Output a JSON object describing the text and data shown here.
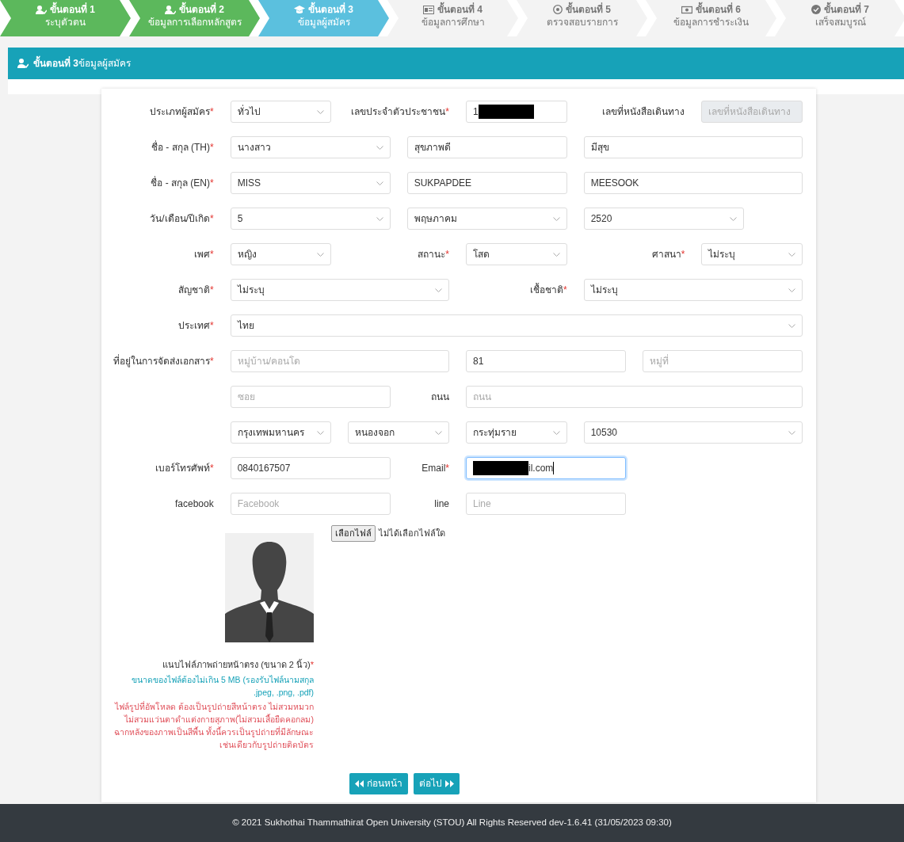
{
  "steps": [
    {
      "number_label": "ขั้นตอนที่ 1",
      "title": "ระบุตัวตน",
      "completed": true,
      "selected": false
    },
    {
      "number_label": "ขั้นตอนที่ 2",
      "title": "ข้อมูลการเลือกหลักสูตร",
      "completed": true,
      "selected": false
    },
    {
      "number_label": "ขั้นตอนที่ 3",
      "title": "ข้อมูลผู้สมัคร",
      "completed": false,
      "selected": true
    },
    {
      "number_label": "ขั้นตอนที่ 4",
      "title": "ข้อมูลการศึกษา",
      "completed": false,
      "selected": false
    },
    {
      "number_label": "ขั้นตอนที่ 5",
      "title": "ตรวจสอบรายการ",
      "completed": false,
      "selected": false
    },
    {
      "number_label": "ขั้นตอนที่ 6",
      "title": "ข้อมูลการชำระเงิน",
      "completed": false,
      "selected": false
    },
    {
      "number_label": "ขั้นตอนที่ 7",
      "title": "เสร็จสมบูรณ์",
      "completed": false,
      "selected": false
    }
  ],
  "section_title": "**ขั้นตอนที่ 3**ข้อมูลผู้สมัคร",
  "form": {
    "rows": [
      {
        "items": [
          {
            "kind": "label",
            "text": "ประเภทผู้สมัคร",
            "mark": "*"
          },
          {
            "kind": "select",
            "value": "ทั่วไป"
          },
          {
            "kind": "label",
            "text": "เลขประจำตัวประชาชน",
            "mark": "*"
          },
          {
            "kind": "input",
            "value": "1",
            "redacted_start": false,
            "redacted_end": true,
            "disabled": false,
            "focused": false
          },
          {
            "kind": "label",
            "text": "เลขที่หนังสือเดินทาง"
          },
          {
            "kind": "input",
            "placeholder": "เลขที่หนังสือเดินทาง",
            "disabled": true,
            "focused": false
          }
        ]
      },
      {
        "items": [
          {
            "kind": "label",
            "text": "ชื่อ - สกุล (TH)",
            "mark": "*"
          },
          {
            "kind": "select",
            "value": "นางสาว"
          },
          {
            "kind": "input",
            "value": "สุขภาพดี",
            "disabled": false,
            "focused": false
          },
          {
            "kind": "input",
            "value": "มีสุข",
            "disabled": false,
            "focused": false
          }
        ]
      },
      {
        "items": [
          {
            "kind": "label",
            "text": "ชื่อ - สกุล (EN)",
            "mark": "*"
          },
          {
            "kind": "select",
            "value": "MISS"
          },
          {
            "kind": "input",
            "value": "SUKPAPDEE",
            "disabled": false,
            "focused": false
          },
          {
            "kind": "input",
            "value": "MEESOOK",
            "disabled": false,
            "focused": false
          }
        ]
      },
      {
        "items": [
          {
            "kind": "label",
            "text": "วัน/เดือน/ปีเกิด",
            "mark": "*"
          },
          {
            "kind": "select",
            "value": "5"
          },
          {
            "kind": "select",
            "value": "พฤษภาคม"
          },
          {
            "kind": "select",
            "value": "2520"
          }
        ]
      },
      {
        "items": [
          {
            "kind": "label",
            "text": "เพศ",
            "mark": "*"
          },
          {
            "kind": "select",
            "value": "หญิง"
          },
          {
            "kind": "label",
            "text": "สถานะ",
            "mark": "*"
          },
          {
            "kind": "select",
            "value": "โสด"
          },
          {
            "kind": "label",
            "text": "ศาสนา",
            "mark": "*"
          },
          {
            "kind": "select",
            "value": "ไม่ระบุ"
          }
        ]
      },
      {
        "items": [
          {
            "kind": "label",
            "text": "สัญชาติ",
            "mark": "*"
          },
          {
            "kind": "select",
            "value": "ไม่ระบุ"
          },
          {
            "kind": "label",
            "text": "เชื้อชาติ",
            "mark": "*"
          },
          {
            "kind": "select",
            "value": "ไม่ระบุ"
          }
        ]
      },
      {
        "items": [
          {
            "kind": "label",
            "text": "ประเทศ",
            "mark": "*"
          },
          {
            "kind": "select",
            "value": "ไทย"
          }
        ]
      },
      {
        "items": [
          {
            "kind": "label",
            "text": "ที่อยู่ในการจัดส่งเอกสาร",
            "mark": "*"
          },
          {
            "kind": "input",
            "placeholder": "หมู่บ้าน/คอนโด",
            "disabled": false,
            "focused": false
          },
          {
            "kind": "input",
            "value": "81",
            "disabled": false,
            "focused": false
          },
          {
            "kind": "input",
            "placeholder": "หมู่ที่",
            "disabled": false,
            "focused": false
          }
        ]
      },
      {
        "items": [
          {
            "kind": "input",
            "placeholder": "ซอย",
            "disabled": false,
            "focused": false
          },
          {
            "kind": "label",
            "text": "ถนน"
          },
          {
            "kind": "input",
            "placeholder": "ถนน",
            "disabled": false,
            "focused": false
          }
        ]
      },
      {
        "items": [
          {
            "kind": "select",
            "value": "กรุงเทพมหานคร"
          },
          {
            "kind": "select",
            "value": "หนองจอก"
          },
          {
            "kind": "select",
            "value": "กระทุ่มราย"
          },
          {
            "kind": "select",
            "value": "10530"
          }
        ]
      },
      {
        "items": [
          {
            "kind": "label",
            "text": "เบอร์โทรศัพท์",
            "mark": "*"
          },
          {
            "kind": "input",
            "value": "0840167507",
            "disabled": false,
            "focused": false
          },
          {
            "kind": "label",
            "text": "Email",
            "mark": "*"
          },
          {
            "kind": "input",
            "value": "il.com",
            "redacted_start": true,
            "redacted_end": false,
            "disabled": false,
            "focused": true
          }
        ]
      },
      {
        "items": [
          {
            "kind": "label",
            "text": "facebook"
          },
          {
            "kind": "input",
            "placeholder": "Facebook",
            "disabled": false,
            "focused": false
          },
          {
            "kind": "label",
            "text": "line"
          },
          {
            "kind": "input",
            "placeholder": "Line",
            "disabled": false,
            "focused": false
          }
        ]
      }
    ]
  },
  "photo": {
    "caption": {
      "text": "แนบไฟล์ภาพถ่ายหน้าตรง (ขนาด 2 นิ้ว)",
      "mark": "*"
    },
    "size_note": "ขนาดของไฟล์ต้องไม่เกิน 5 MB (รองรับไฟล์นามสกุล .jpeg, .png, .pdf)",
    "rule_note": "ไฟล์รูปที่อัพโหลด ต้องเป็นรูปถ่ายสีหน้าตรง ไม่สวมหมวก ไม่สวมแว่นตาดำแต่งกายสุภาพ(ไม่สวมเสื้อยืดคอกลม) ฉากหลังของภาพเป็นสีพื้น ทั้งนี้ควรเป็นรูปถ่ายที่มีลักษณะเช่นเดียวกับรูปถ่ายติดบัตร",
    "file_input": {
      "button": "เลือกไฟล์",
      "status": "ไม่ได้เลือกไฟล์ใด"
    }
  },
  "buttons": [
    {
      "kind": "prev",
      "label": "ก่อนหน้า"
    },
    {
      "kind": "next",
      "label": "ต่อไป"
    }
  ],
  "footer": "© 2021 Sukhothai Thammathirat Open University (STOU) All Rights Reserved dev-1.6.41 (31/05/2023 09:30)"
}
